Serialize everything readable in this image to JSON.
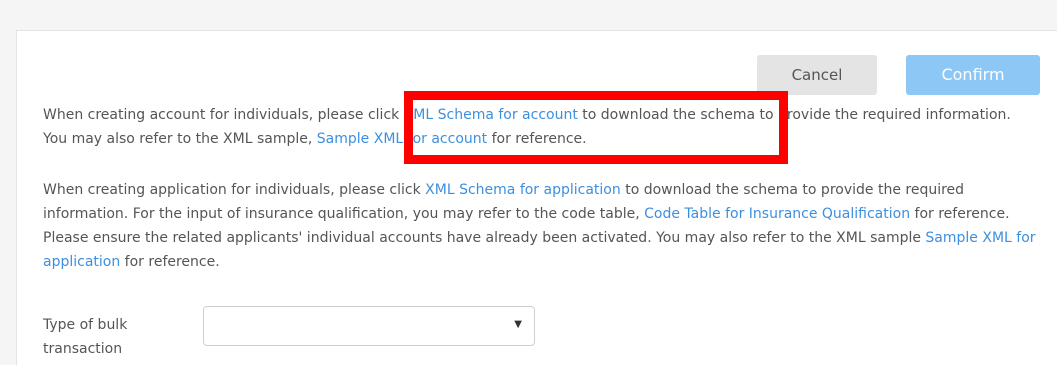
{
  "actions": {
    "cancel_label": "Cancel",
    "confirm_label": "Confirm"
  },
  "instructions": {
    "account": {
      "t1": "When creating account for individuals, please click ",
      "link_schema": "XML Schema for account",
      "t2": " to download the schema to provide the required information. You may also refer to the XML sample, ",
      "link_sample": "Sample XML for account",
      "t3": " for reference."
    },
    "application": {
      "t1": "When creating application for individuals, please click ",
      "link_schema": "XML Schema for application",
      "t2": " to download the schema to provide the required information. For the input of insurance qualification, you may refer to the code table, ",
      "link_code_table": "Code Table for Insurance Qualification",
      "t3": " for reference. Please ensure the related applicants' individual accounts have already been activated. You may also refer to the XML sample ",
      "link_sample": "Sample XML for application",
      "t4": " for reference."
    }
  },
  "form": {
    "bulk_type_label": "Type of bulk transaction",
    "bulk_type_value": "",
    "caret_icon": "chevron-down-icon"
  },
  "colors": {
    "link": "#3d8fe0",
    "confirm_bg": "#8cc7f5",
    "cancel_bg": "#e4e4e4",
    "highlight": "#ff0000"
  }
}
